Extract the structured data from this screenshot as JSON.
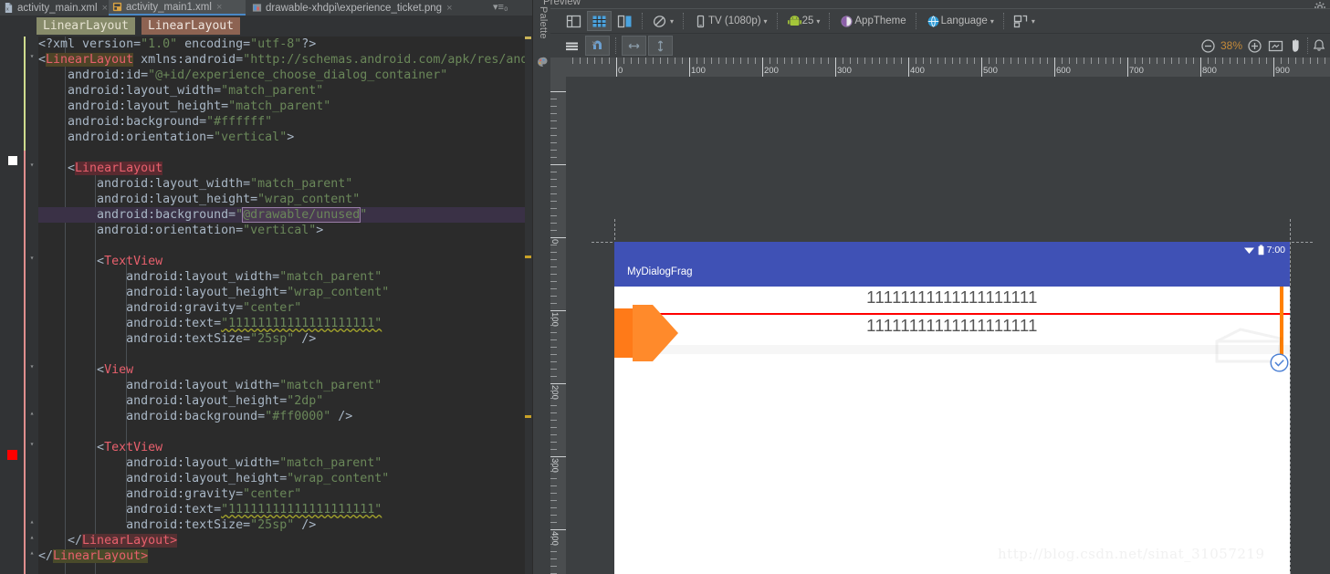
{
  "editor": {
    "tabs": [
      {
        "label": "activity_main.xml",
        "icon": "xml-file-icon",
        "close": "×",
        "active": false
      },
      {
        "label": "activity_main1.xml",
        "icon": "xml-layout-file-icon",
        "close": "×",
        "active": true
      },
      {
        "label": "drawable-xhdpi\\experience_ticket.png",
        "icon": "image-file-icon",
        "close": "×",
        "active": false
      }
    ],
    "tabs_overflow": "▾≡₀",
    "breadcrumbs": [
      {
        "label": "LinearLayout"
      },
      {
        "label": "LinearLayout"
      }
    ],
    "code_lines": [
      {
        "indent": 0,
        "segs": [
          {
            "t": "<?xml version=",
            "c": "pi"
          },
          {
            "t": "\"1.0\"",
            "c": "val"
          },
          {
            "t": " encoding=",
            "c": "pi"
          },
          {
            "t": "\"utf-8\"",
            "c": "val"
          },
          {
            "t": "?>",
            "c": "pi"
          }
        ]
      },
      {
        "indent": 0,
        "segs": [
          {
            "t": "<",
            "c": "punct"
          },
          {
            "t": "LinearLayout",
            "c": "tagname-bg1"
          },
          {
            "t": " xmlns:android=",
            "c": "attrname"
          },
          {
            "t": "\"http://schemas.android.com/apk/res/andr",
            "c": "val"
          }
        ]
      },
      {
        "indent": 1,
        "segs": [
          {
            "t": "android:id=",
            "c": "attrname"
          },
          {
            "t": "\"@+id/experience_choose_dialog_container\"",
            "c": "val"
          }
        ]
      },
      {
        "indent": 1,
        "segs": [
          {
            "t": "android:layout_width=",
            "c": "attrname"
          },
          {
            "t": "\"match_parent\"",
            "c": "val"
          }
        ]
      },
      {
        "indent": 1,
        "segs": [
          {
            "t": "android:layout_height=",
            "c": "attrname"
          },
          {
            "t": "\"match_parent\"",
            "c": "val"
          }
        ]
      },
      {
        "indent": 1,
        "segs": [
          {
            "t": "android:background=",
            "c": "attrname"
          },
          {
            "t": "\"#ffffff\"",
            "c": "val"
          }
        ]
      },
      {
        "indent": 1,
        "segs": [
          {
            "t": "android:orientation=",
            "c": "attrname"
          },
          {
            "t": "\"vertical\"",
            "c": "val"
          },
          {
            "t": ">",
            "c": "punct"
          }
        ]
      },
      {
        "indent": 0,
        "segs": []
      },
      {
        "indent": 1,
        "segs": [
          {
            "t": "<",
            "c": "punct"
          },
          {
            "t": "LinearLayout",
            "c": "tagname-bg2"
          }
        ]
      },
      {
        "indent": 2,
        "segs": [
          {
            "t": "android:layout_width=",
            "c": "attrname"
          },
          {
            "t": "\"match_parent\"",
            "c": "val"
          }
        ]
      },
      {
        "indent": 2,
        "segs": [
          {
            "t": "android:layout_height=",
            "c": "attrname"
          },
          {
            "t": "\"wrap_content\"",
            "c": "val"
          }
        ]
      },
      {
        "indent": 2,
        "highlight": true,
        "segs": [
          {
            "t": "android:background=",
            "c": "attrname"
          },
          {
            "t": "\"",
            "c": "val"
          },
          {
            "t": "@drawable/unused",
            "c": "hlval"
          },
          {
            "t": "\"",
            "c": "val"
          }
        ]
      },
      {
        "indent": 2,
        "segs": [
          {
            "t": "android:orientation=",
            "c": "attrname"
          },
          {
            "t": "\"vertical\"",
            "c": "val"
          },
          {
            "t": ">",
            "c": "punct"
          }
        ]
      },
      {
        "indent": 0,
        "segs": []
      },
      {
        "indent": 2,
        "segs": [
          {
            "t": "<",
            "c": "punct"
          },
          {
            "t": "TextView",
            "c": "tagname"
          }
        ]
      },
      {
        "indent": 3,
        "segs": [
          {
            "t": "android:layout_width=",
            "c": "attrname"
          },
          {
            "t": "\"match_parent\"",
            "c": "val"
          }
        ]
      },
      {
        "indent": 3,
        "segs": [
          {
            "t": "android:layout_height=",
            "c": "attrname"
          },
          {
            "t": "\"wrap_content\"",
            "c": "val"
          }
        ]
      },
      {
        "indent": 3,
        "segs": [
          {
            "t": "android:gravity=",
            "c": "attrname"
          },
          {
            "t": "\"center\"",
            "c": "val"
          }
        ]
      },
      {
        "indent": 3,
        "segs": [
          {
            "t": "android:text=",
            "c": "attrname"
          },
          {
            "t": "\"11111111111111111111\"",
            "c": "val squig"
          }
        ]
      },
      {
        "indent": 3,
        "segs": [
          {
            "t": "android:textSize=",
            "c": "attrname"
          },
          {
            "t": "\"25sp\"",
            "c": "val"
          },
          {
            "t": " />",
            "c": "punct"
          }
        ]
      },
      {
        "indent": 0,
        "segs": []
      },
      {
        "indent": 2,
        "segs": [
          {
            "t": "<",
            "c": "punct"
          },
          {
            "t": "View",
            "c": "tagname"
          }
        ]
      },
      {
        "indent": 3,
        "segs": [
          {
            "t": "android:layout_width=",
            "c": "attrname"
          },
          {
            "t": "\"match_parent\"",
            "c": "val"
          }
        ]
      },
      {
        "indent": 3,
        "segs": [
          {
            "t": "android:layout_height=",
            "c": "attrname"
          },
          {
            "t": "\"2dp\"",
            "c": "val"
          }
        ]
      },
      {
        "indent": 3,
        "segs": [
          {
            "t": "android:background=",
            "c": "attrname"
          },
          {
            "t": "\"#ff0000\"",
            "c": "val"
          },
          {
            "t": " />",
            "c": "punct"
          }
        ]
      },
      {
        "indent": 0,
        "segs": []
      },
      {
        "indent": 2,
        "segs": [
          {
            "t": "<",
            "c": "punct"
          },
          {
            "t": "TextView",
            "c": "tagname"
          }
        ]
      },
      {
        "indent": 3,
        "segs": [
          {
            "t": "android:layout_width=",
            "c": "attrname"
          },
          {
            "t": "\"match_parent\"",
            "c": "val"
          }
        ]
      },
      {
        "indent": 3,
        "segs": [
          {
            "t": "android:layout_height=",
            "c": "attrname"
          },
          {
            "t": "\"wrap_content\"",
            "c": "val"
          }
        ]
      },
      {
        "indent": 3,
        "segs": [
          {
            "t": "android:gravity=",
            "c": "attrname"
          },
          {
            "t": "\"center\"",
            "c": "val"
          }
        ]
      },
      {
        "indent": 3,
        "segs": [
          {
            "t": "android:text=",
            "c": "attrname"
          },
          {
            "t": "\"11111111111111111111\"",
            "c": "val squig"
          }
        ]
      },
      {
        "indent": 3,
        "segs": [
          {
            "t": "android:textSize=",
            "c": "attrname"
          },
          {
            "t": "\"25sp\"",
            "c": "val"
          },
          {
            "t": " />",
            "c": "punct"
          }
        ]
      },
      {
        "indent": 1,
        "segs": [
          {
            "t": "</",
            "c": "punct"
          },
          {
            "t": "LinearLayout>",
            "c": "tagname-bg4"
          }
        ]
      },
      {
        "indent": 0,
        "segs": [
          {
            "t": "</",
            "c": "punct"
          },
          {
            "t": "LinearLayout>",
            "c": "tagname-bg3"
          }
        ]
      }
    ]
  },
  "palette": {
    "label": "Palette",
    "icon": "palette-icon"
  },
  "preview": {
    "title": "Preview",
    "toolbar": [
      {
        "name": "design-surface-toggle",
        "icon": "layout-panel-icon",
        "label": ""
      },
      {
        "name": "blueprint-toggle",
        "icon": "blueprint-grid-icon",
        "label": "",
        "selected": true
      },
      {
        "name": "both-panes-toggle",
        "icon": "split-panes-icon",
        "label": ""
      },
      {
        "name": "orientation-selector",
        "icon": "rotate-device-icon",
        "label": "",
        "caret": true
      },
      {
        "name": "device-selector",
        "icon": "phone-icon",
        "label": "TV (1080p)",
        "caret": true
      },
      {
        "name": "api-level-selector",
        "icon": "android-robot-icon",
        "label": "25",
        "caret": true
      },
      {
        "name": "theme-selector",
        "icon": "theme-circle-icon",
        "label": "AppTheme"
      },
      {
        "name": "language-selector",
        "icon": "globe-icon",
        "label": "Language",
        "caret": true
      },
      {
        "name": "layout-variants-selector",
        "icon": "variants-icon",
        "label": "",
        "caret": true
      }
    ],
    "toolbar2": [
      {
        "name": "show-constraints-toggle",
        "icon": "lines-icon"
      },
      {
        "name": "autoconnect-toggle",
        "icon": "magnet-icon",
        "selected": true
      },
      {
        "name": "horizontal-margin-tool",
        "icon": "arrows-horizontal-icon",
        "selected": true
      },
      {
        "name": "vertical-margin-tool",
        "icon": "arrows-vertical-icon",
        "selected": true
      }
    ],
    "zoom": {
      "out_icon": "zoom-out-icon",
      "level": "38%",
      "in_icon": "zoom-in-icon",
      "fit_icon": "zoom-to-fit-icon",
      "pan_icon": "pan-hand-icon",
      "notify_icon": "bell-icon"
    },
    "settings_icon": "gear-icon",
    "ruler": {
      "h_labels": [
        "0",
        "100",
        "200",
        "300",
        "400",
        "500",
        "600",
        "700",
        "800",
        "900"
      ],
      "v_labels": [
        "0",
        "100",
        "200",
        "300",
        "400"
      ]
    },
    "device": {
      "statusbar": {
        "wifi_icon": "wifi-icon",
        "battery_icon": "battery-icon",
        "time": "7:00"
      },
      "appbar_title": "MyDialogFrag",
      "textview_1": "11111111111111111111",
      "textview_2": "11111111111111111111",
      "divider_color": "#ff0000",
      "appbar_color": "#3f51b5",
      "arrow_icon": "orange-arrow-overlay",
      "orange_bar_color": "#ff8000",
      "watermark_icon": "ticket-watermark-icon",
      "check_badge_icon": "check-circle-icon"
    }
  },
  "watermark": "http://blog.csdn.net/sinat_31057219"
}
